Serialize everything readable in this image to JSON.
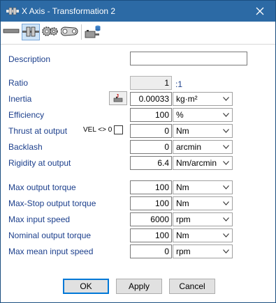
{
  "window": {
    "title": "X Axis - Transformation 2",
    "app_icon": "gear-axis-icon",
    "close_icon": "close-icon"
  },
  "toolbar": {
    "buttons": [
      {
        "icon": "shaft-icon",
        "active": false
      },
      {
        "icon": "coupling-icon",
        "active": true
      },
      {
        "icon": "gears-icon",
        "active": false
      },
      {
        "icon": "belt-pulley-icon",
        "active": false
      },
      {
        "icon": "motor-library-icon",
        "active": false
      }
    ]
  },
  "form": {
    "description": {
      "label": "Description",
      "value": ""
    },
    "ratio": {
      "label": "Ratio",
      "value": "1",
      "suffix": ":1"
    },
    "inertia": {
      "label": "Inertia",
      "value": "0.00033",
      "unit": "kg·m²",
      "calc_icon": "inertia-calculator-icon"
    },
    "efficiency": {
      "label": "Efficiency",
      "value": "100",
      "unit": "%"
    },
    "thrust": {
      "label": "Thrust at output",
      "vel_label": "VEL <> 0",
      "checked": false,
      "value": "0",
      "unit": "Nm"
    },
    "backlash": {
      "label": "Backlash",
      "value": "0",
      "unit": "arcmin"
    },
    "rigidity": {
      "label": "Rigidity at output",
      "value": "6.4",
      "unit": "Nm/arcmin"
    },
    "max_output_torque": {
      "label": "Max output torque",
      "value": "100",
      "unit": "Nm"
    },
    "max_stop_torque": {
      "label": "Max-Stop output torque",
      "value": "100",
      "unit": "Nm"
    },
    "max_input_speed": {
      "label": "Max input speed",
      "value": "6000",
      "unit": "rpm"
    },
    "nominal_output_torque": {
      "label": "Nominal output torque",
      "value": "100",
      "unit": "Nm"
    },
    "max_mean_input_speed": {
      "label": "Max mean input speed",
      "value": "0",
      "unit": "rpm"
    }
  },
  "buttons": {
    "ok": "OK",
    "apply": "Apply",
    "cancel": "Cancel"
  },
  "colors": {
    "titlebar": "#2c6aa5",
    "label_text": "#1c3f8c",
    "default_button_border": "#0078d7"
  }
}
